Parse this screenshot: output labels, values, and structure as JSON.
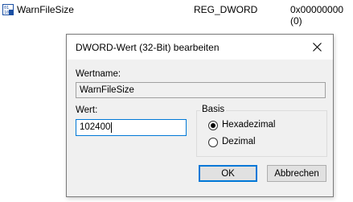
{
  "registry_row": {
    "name": "WarnFileSize",
    "type": "REG_DWORD",
    "data": "0x00000000 (0)"
  },
  "dialog": {
    "title": "DWORD-Wert (32-Bit) bearbeiten",
    "value_name_label": "Wertname:",
    "value_name": "WarnFileSize",
    "value_data_label": "Wert:",
    "value_data": "102400",
    "base_label": "Basis",
    "base_options": [
      {
        "label": "Hexadezimal",
        "selected": true
      },
      {
        "label": "Dezimal",
        "selected": false
      }
    ],
    "ok_label": "OK",
    "cancel_label": "Abbrechen"
  },
  "icons": {
    "registry_value": "binary-value-icon",
    "close": "close-icon"
  },
  "colors": {
    "accent": "#0078d7",
    "dialog_bg": "#f0f0f0",
    "icon_blue": "#1a4fa3"
  }
}
